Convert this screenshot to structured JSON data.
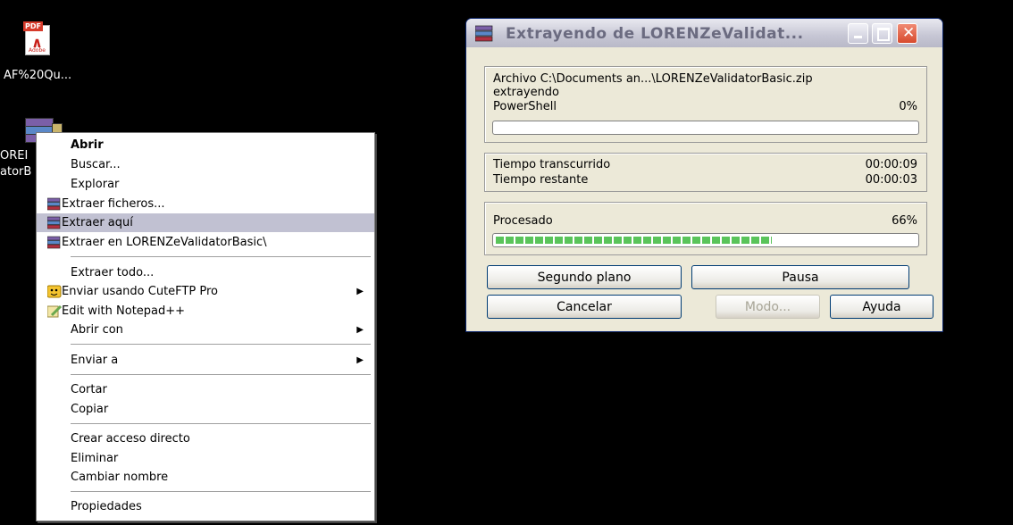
{
  "desktop": {
    "pdf_icon_badge": "PDF",
    "pdf_icon_sub": "Adobe",
    "pdf_label": "AF%20Qu...",
    "rar_label_line1": "OREI",
    "rar_label_line2": "atorB"
  },
  "context_menu": {
    "items": [
      {
        "label": "Abrir",
        "bold": true,
        "icon": null
      },
      {
        "label": "Buscar...",
        "icon": null
      },
      {
        "label": "Explorar",
        "icon": null
      },
      {
        "label": "Extraer ficheros...",
        "icon": "winrar-icon"
      },
      {
        "label": "Extraer aquí",
        "icon": "winrar-icon",
        "highlighted": true
      },
      {
        "label": "Extraer en LORENZeValidatorBasic\\",
        "icon": "winrar-icon"
      },
      {
        "label": "Extraer todo...",
        "icon": null
      },
      {
        "label": "Enviar usando CuteFTP Pro",
        "icon": "cuteftp-icon",
        "submenu": true
      },
      {
        "label": "Edit with Notepad++",
        "icon": "notepad-plus-icon"
      },
      {
        "label": "Abrir con",
        "icon": null,
        "submenu": true
      },
      {
        "label": "Enviar a",
        "icon": null,
        "submenu": true
      },
      {
        "label": "Cortar",
        "icon": null
      },
      {
        "label": "Copiar",
        "icon": null
      },
      {
        "label": "Crear acceso directo",
        "icon": null
      },
      {
        "label": "Eliminar",
        "icon": null
      },
      {
        "label": "Cambiar nombre",
        "icon": null
      },
      {
        "label": "Propiedades",
        "icon": null
      }
    ]
  },
  "dialog": {
    "title": "Extrayendo de LORENZeValidat...",
    "archive_line": "Archivo C:\\Documents an...\\LORENZeValidatorBasic.zip",
    "status": "extrayendo",
    "current_file": "PowerShell",
    "file_percent": "0%",
    "file_progress": 0,
    "elapsed_label": "Tiempo transcurrido",
    "elapsed_value": "00:00:09",
    "remaining_label": "Tiempo restante",
    "remaining_value": "00:00:03",
    "processed_label": "Procesado",
    "processed_percent": "66%",
    "processed_progress": 0.66,
    "buttons": {
      "background": "Segundo plano",
      "pause": "Pausa",
      "cancel": "Cancelar",
      "mode": "Modo...",
      "help": "Ayuda"
    }
  },
  "colors": {
    "menu_highlight": "#c1c1d2",
    "progress_fill": "#5ac45a",
    "dialog_bg": "#ece9d8"
  }
}
